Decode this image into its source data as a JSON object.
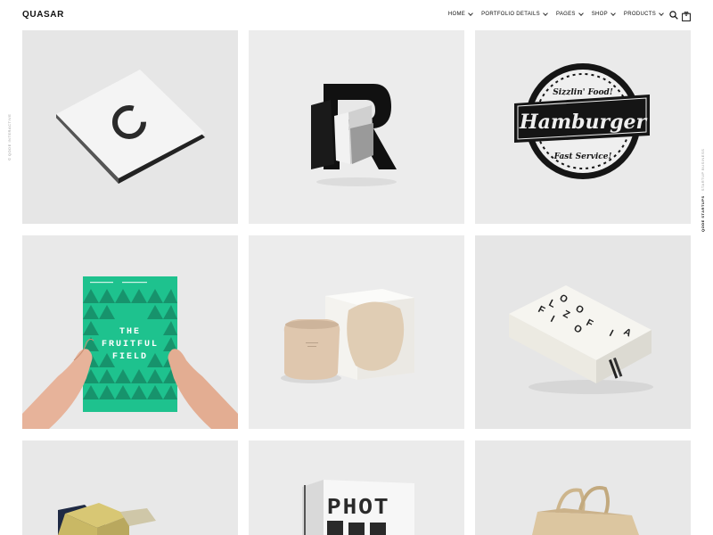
{
  "header": {
    "logo": "QUASAR",
    "nav": [
      {
        "label": "HOME",
        "has_dropdown": true
      },
      {
        "label": "PORTFOLIO DETAILS",
        "has_dropdown": true
      },
      {
        "label": "PAGES",
        "has_dropdown": true
      },
      {
        "label": "SHOP",
        "has_dropdown": true
      },
      {
        "label": "PRODUCTS",
        "has_dropdown": true
      }
    ],
    "search_icon": "search-icon",
    "cart_icon": "shopping-bag-icon",
    "cart_count": "0"
  },
  "sidebar": {
    "left_text": "© QODE INTERACTIVE",
    "right_text_bold": "QODE STARTUPS",
    "right_text": " · STARTUP BUSINESS"
  },
  "portfolio": {
    "items": [
      {
        "name": "business-card-o",
        "icon": "letter-o-logo"
      },
      {
        "name": "3d-letter-r",
        "icon": "letter-r-sculpture"
      },
      {
        "name": "hamburger-badge",
        "badge_top": "Sizzlin' Food!",
        "badge_main": "Hamburger",
        "badge_bottom": "Fast Service!"
      },
      {
        "name": "fruitful-field-book",
        "title_line1": "THE",
        "title_line2": "FRUITFUL",
        "title_line3": "FIELD"
      },
      {
        "name": "cosmetic-jar-box"
      },
      {
        "name": "filozofia-book",
        "letters": "FILOZOFIA"
      },
      {
        "name": "folded-paper"
      },
      {
        "name": "photography-book",
        "title": "PHOT"
      },
      {
        "name": "tote-bag"
      }
    ]
  }
}
